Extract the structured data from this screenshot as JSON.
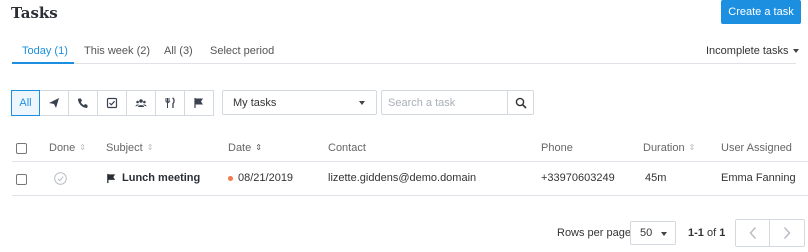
{
  "header": {
    "title": "Tasks",
    "create_label": "Create a task"
  },
  "tabs": [
    {
      "label": "Today (1)",
      "active": true
    },
    {
      "label": "This week (2)",
      "active": false
    },
    {
      "label": "All (3)",
      "active": false
    },
    {
      "label": "Select period",
      "active": false
    }
  ],
  "status_filter": {
    "selected": "Incomplete tasks"
  },
  "type_filters": [
    {
      "label": "All",
      "active": true
    },
    {
      "icon": "send-icon"
    },
    {
      "icon": "phone-icon"
    },
    {
      "icon": "checkbox-icon"
    },
    {
      "icon": "group-icon"
    },
    {
      "icon": "fork-knife-icon"
    },
    {
      "icon": "flag-icon"
    }
  ],
  "owner_select": {
    "selected": "My tasks"
  },
  "search": {
    "placeholder": "Search a task",
    "value": ""
  },
  "table": {
    "columns": [
      "Done",
      "Subject",
      "Date",
      "Contact",
      "Phone",
      "Duration",
      "User Assigned"
    ],
    "rows": [
      {
        "subject": "Lunch meeting",
        "subject_icon": "flag-icon",
        "date": "08/21/2019",
        "date_status_color": "#f07a4a",
        "contact": "lizette.giddens@demo.domain",
        "phone": "+33970603249",
        "duration": "45m",
        "user_assigned": "Emma Fanning"
      }
    ]
  },
  "pagination": {
    "rows_per_page_label": "Rows per page",
    "rows_per_page": "50",
    "range": "1-1",
    "of_label": "of",
    "total": "1"
  },
  "colors": {
    "accent": "#1d8fe1",
    "border": "#d4d9df",
    "date_dot": "#f07a4a"
  }
}
